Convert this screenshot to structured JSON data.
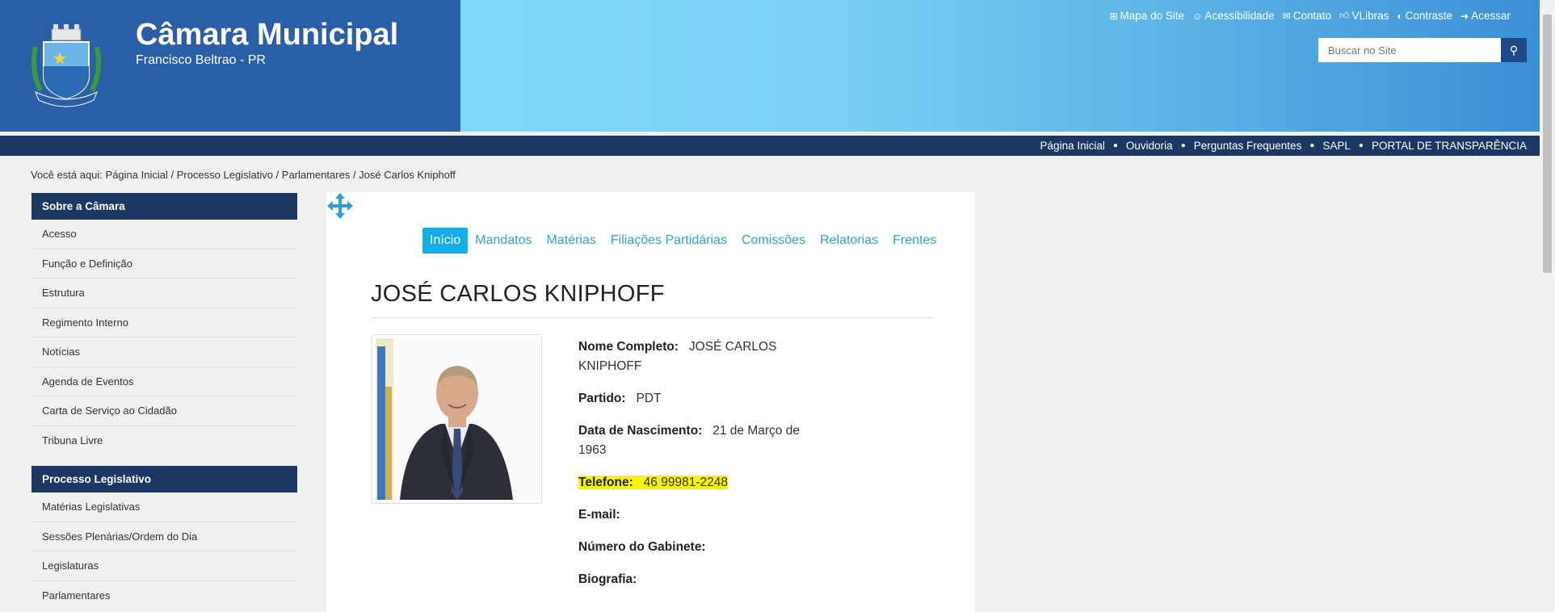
{
  "header": {
    "title": "Câmara Municipal",
    "subtitle": "Francisco Beltrao - PR",
    "top_links": [
      {
        "icon": "sitemap-icon",
        "label": "Mapa do Site"
      },
      {
        "icon": "smile-icon",
        "label": "Acessibilidade"
      },
      {
        "icon": "envelope-icon",
        "label": "Contato"
      },
      {
        "icon": "thumbs-up-icon",
        "label": "VLibras"
      },
      {
        "icon": "contrast-icon",
        "label": "Contraste"
      },
      {
        "icon": "sign-in-icon",
        "label": "Acessar"
      }
    ],
    "search_placeholder": "Buscar no Site"
  },
  "nav": [
    "Página Inicial",
    "Ouvidoria",
    "Perguntas Frequentes",
    "SAPL",
    "PORTAL DE TRANSPARÊNCIA"
  ],
  "breadcrumb": {
    "prefix": "Você está aqui:",
    "items": [
      "Página Inicial",
      "Processo Legislativo",
      "Parlamentares"
    ],
    "current": "José Carlos Kniphoff"
  },
  "sidebar": {
    "sections": [
      {
        "title": "Sobre a Câmara",
        "items": [
          "Acesso",
          "Função e Definição",
          "Estrutura",
          "Regimento Interno",
          "Notícias",
          "Agenda de Eventos",
          "Carta de Serviço ao Cidadão",
          "Tribuna Livre"
        ]
      },
      {
        "title": "Processo Legislativo",
        "items": [
          "Matérias Legislativas",
          "Sessões Plenárias/Ordem do Dia",
          "Legislaturas",
          "Parlamentares"
        ]
      }
    ]
  },
  "tabs": [
    "Início",
    "Mandatos",
    "Matérias",
    "Filiações Partidárias",
    "Comissões",
    "Relatorias",
    "Frentes"
  ],
  "profile": {
    "name": "JOSÉ CARLOS KNIPHOFF",
    "fields": [
      {
        "label": "Nome Completo:",
        "value": "JOSÉ CARLOS KNIPHOFF"
      },
      {
        "label": "Partido:",
        "value": "PDT"
      },
      {
        "label": "Data de Nascimento:",
        "value": "21 de Março de 1963"
      },
      {
        "label": "Telefone:",
        "value": "46 99981-2248"
      },
      {
        "label": "E-mail:",
        "value": ""
      },
      {
        "label": "Número do Gabinete:",
        "value": ""
      },
      {
        "label": "Biografia:",
        "value": ""
      }
    ]
  },
  "colors": {
    "header_blue": "#2a5ea7",
    "nav_dark": "#1c3764",
    "tab_active": "#13aee5",
    "highlight": "#f6f400"
  }
}
